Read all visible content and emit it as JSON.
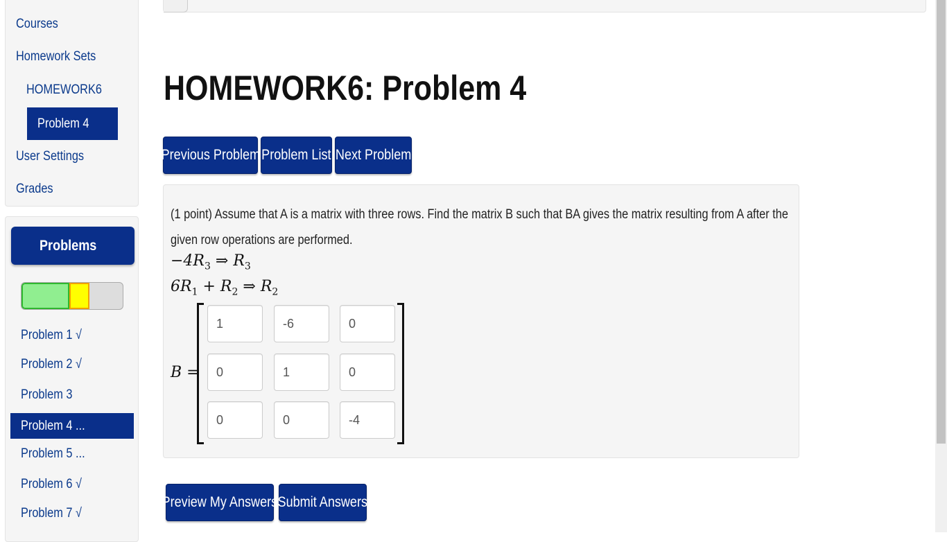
{
  "nav": {
    "courses": "Courses",
    "homework_sets": "Homework Sets",
    "set_name": "HOMEWORK6",
    "current_problem": "Problem 4",
    "user_settings": "User Settings",
    "grades": "Grades"
  },
  "problems_panel": {
    "header": "Problems",
    "progress": {
      "correct_fraction": 0.47,
      "partial_fraction": 0.2
    },
    "items": [
      {
        "label": "Problem 1 √",
        "status": "correct"
      },
      {
        "label": "Problem 2 √",
        "status": "correct"
      },
      {
        "label": "Problem 3",
        "status": "unanswered"
      },
      {
        "label": "Problem 4 ...",
        "status": "active"
      },
      {
        "label": "Problem 5 ...",
        "status": "incomplete"
      },
      {
        "label": "Problem 6 √",
        "status": "correct"
      },
      {
        "label": "Problem 7 √",
        "status": "correct"
      }
    ]
  },
  "title": "HOMEWORK6: Problem 4",
  "nav_buttons": {
    "previous": "Previous Problem",
    "list": "Problem List",
    "next": "Next Problem"
  },
  "problem": {
    "text": "(1 point) Assume that A is a matrix with three rows. Find the matrix B such that BA gives the matrix resulting from A after the given row operations are performed.",
    "op1": {
      "lhs": "−4R",
      "sub1": "3",
      "arrow": " ⇒ ",
      "rhs": "R",
      "sub2": "3"
    },
    "op2": {
      "a": "6R",
      "sub_a": "1",
      "plus": " + ",
      "b": "R",
      "sub_b": "2",
      "arrow": " ⇒ ",
      "rhs": "R",
      "sub_rhs": "2"
    },
    "matrix_label": "B =",
    "matrix": [
      [
        "1",
        "-6",
        "0"
      ],
      [
        "0",
        "1",
        "0"
      ],
      [
        "0",
        "0",
        "-4"
      ]
    ]
  },
  "actions": {
    "preview": "Preview My Answers",
    "submit": "Submit Answers"
  },
  "colors": {
    "primary": "#0a2f8a",
    "link": "#0b3a8c",
    "progress_correct": "#90ee90",
    "progress_partial": "#ffff00"
  }
}
